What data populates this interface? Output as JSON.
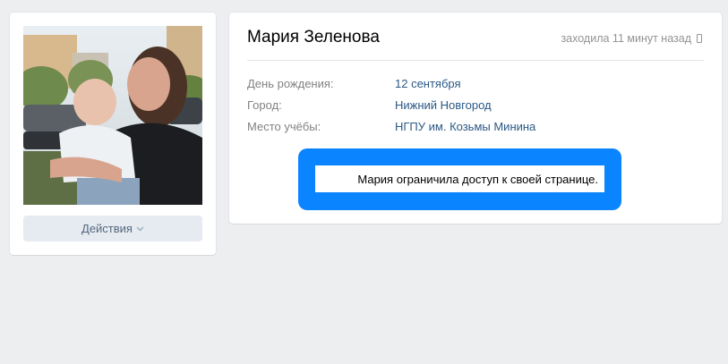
{
  "profile": {
    "name": "Мария Зеленова",
    "last_seen": "заходила 11 минут назад",
    "last_seen_icon": "mobile-phone-icon",
    "actions_label": "Действия",
    "actions_icon": "chevron-down-icon",
    "photo_icon": "profile-photo"
  },
  "info": [
    {
      "label": "День рождения:",
      "value": "12 сентября"
    },
    {
      "label": "Город:",
      "value": "Нижний Новгород"
    },
    {
      "label": "Место учёбы:",
      "value": "НГПУ им. Козьмы Минина"
    }
  ],
  "restricted": {
    "message": "Мария ограничила доступ к своей странице."
  },
  "colors": {
    "background": "#edeef0",
    "link": "#2a5885",
    "highlight": "#0a84ff",
    "button_bg": "#e5ebf1"
  }
}
